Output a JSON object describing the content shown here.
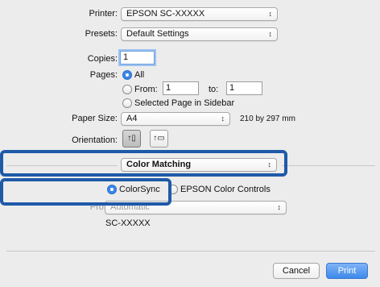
{
  "printer": {
    "label": "Printer:",
    "value": "EPSON SC-XXXXX"
  },
  "presets": {
    "label": "Presets:",
    "value": "Default Settings"
  },
  "copies": {
    "label": "Copies:",
    "value": "1"
  },
  "pages": {
    "label": "Pages:",
    "all_label": "All",
    "from_label": "From:",
    "from_value": "1",
    "to_label": "to:",
    "to_value": "1",
    "selected_label": "Selected Page in Sidebar",
    "selected_option": "All"
  },
  "paper_size": {
    "label": "Paper Size:",
    "value": "A4",
    "dimensions": "210 by 297 mm"
  },
  "orientation": {
    "label": "Orientation:",
    "selected": "portrait"
  },
  "section_popup": {
    "value": "Color Matching"
  },
  "color_matching": {
    "colorsync_label": "ColorSync",
    "epson_label": "EPSON Color Controls",
    "selected": "ColorSync",
    "profile_label": "Profile:",
    "profile_value": "Automatic",
    "printer_model": "SC-XXXXX"
  },
  "buttons": {
    "cancel": "Cancel",
    "print": "Print"
  },
  "colors": {
    "highlight": "#1e5aa8",
    "accent": "#3b86e8"
  }
}
